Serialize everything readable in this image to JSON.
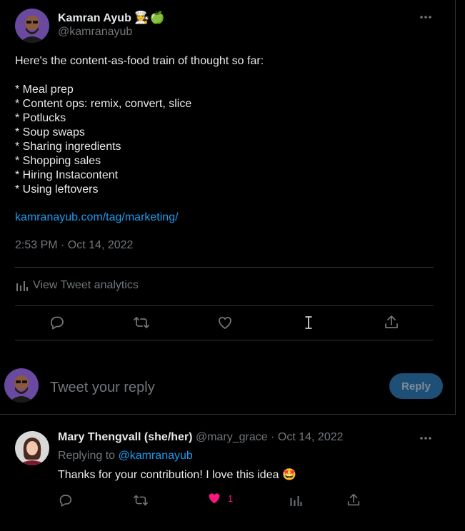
{
  "tweet": {
    "author_name": "Kamran Ayub",
    "author_emoji": "👩‍🍳🍏",
    "author_handle": "@kamranayub",
    "intro": "Here's the content-as-food train of thought so far:",
    "bullets": [
      "* Meal prep",
      "* Content ops: remix, convert, slice",
      "* Potlucks",
      "* Soup swaps",
      "* Sharing ingredients",
      "* Shopping sales",
      "* Hiring Instacontent",
      "* Using leftovers"
    ],
    "link": "kamranayub.com/tag/marketing/",
    "timestamp": "2:53 PM · Oct 14, 2022",
    "analytics_label": "View Tweet analytics"
  },
  "compose": {
    "placeholder": "Tweet your reply",
    "reply_button": "Reply"
  },
  "reply": {
    "author_name": "Mary Thengvall (she/her)",
    "author_handle": "@mary_grace",
    "date": "· Oct 14, 2022",
    "replying_to_label": "Replying to",
    "replying_to_handle": "@kamranayub",
    "text": "Thanks for your contribution! I love this idea",
    "text_emoji": "🤩",
    "like_count": "1"
  },
  "colors": {
    "background": "#000000",
    "text": "#e7e9ea",
    "muted": "#71767b",
    "link": "#1d9bf0",
    "like_active": "#f91880",
    "reply_button_bg": "#1d4f77"
  }
}
